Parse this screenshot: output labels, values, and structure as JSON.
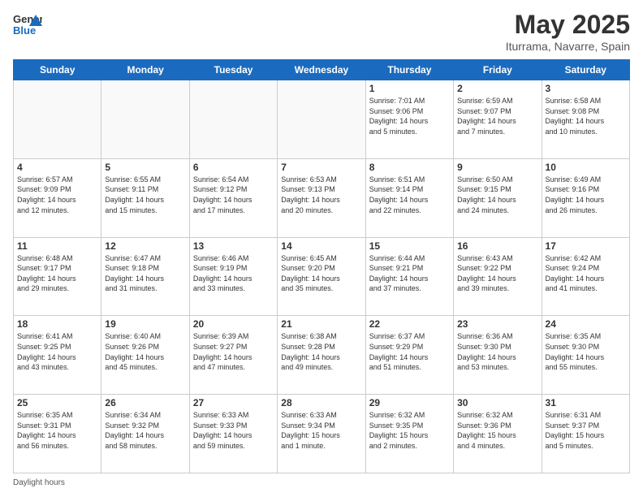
{
  "header": {
    "logo_general": "General",
    "logo_blue": "Blue",
    "month_title": "May 2025",
    "location": "Iturrama, Navarre, Spain"
  },
  "days_of_week": [
    "Sunday",
    "Monday",
    "Tuesday",
    "Wednesday",
    "Thursday",
    "Friday",
    "Saturday"
  ],
  "weeks": [
    [
      {
        "day": "",
        "info": ""
      },
      {
        "day": "",
        "info": ""
      },
      {
        "day": "",
        "info": ""
      },
      {
        "day": "",
        "info": ""
      },
      {
        "day": "1",
        "info": "Sunrise: 7:01 AM\nSunset: 9:06 PM\nDaylight: 14 hours\nand 5 minutes."
      },
      {
        "day": "2",
        "info": "Sunrise: 6:59 AM\nSunset: 9:07 PM\nDaylight: 14 hours\nand 7 minutes."
      },
      {
        "day": "3",
        "info": "Sunrise: 6:58 AM\nSunset: 9:08 PM\nDaylight: 14 hours\nand 10 minutes."
      }
    ],
    [
      {
        "day": "4",
        "info": "Sunrise: 6:57 AM\nSunset: 9:09 PM\nDaylight: 14 hours\nand 12 minutes."
      },
      {
        "day": "5",
        "info": "Sunrise: 6:55 AM\nSunset: 9:11 PM\nDaylight: 14 hours\nand 15 minutes."
      },
      {
        "day": "6",
        "info": "Sunrise: 6:54 AM\nSunset: 9:12 PM\nDaylight: 14 hours\nand 17 minutes."
      },
      {
        "day": "7",
        "info": "Sunrise: 6:53 AM\nSunset: 9:13 PM\nDaylight: 14 hours\nand 20 minutes."
      },
      {
        "day": "8",
        "info": "Sunrise: 6:51 AM\nSunset: 9:14 PM\nDaylight: 14 hours\nand 22 minutes."
      },
      {
        "day": "9",
        "info": "Sunrise: 6:50 AM\nSunset: 9:15 PM\nDaylight: 14 hours\nand 24 minutes."
      },
      {
        "day": "10",
        "info": "Sunrise: 6:49 AM\nSunset: 9:16 PM\nDaylight: 14 hours\nand 26 minutes."
      }
    ],
    [
      {
        "day": "11",
        "info": "Sunrise: 6:48 AM\nSunset: 9:17 PM\nDaylight: 14 hours\nand 29 minutes."
      },
      {
        "day": "12",
        "info": "Sunrise: 6:47 AM\nSunset: 9:18 PM\nDaylight: 14 hours\nand 31 minutes."
      },
      {
        "day": "13",
        "info": "Sunrise: 6:46 AM\nSunset: 9:19 PM\nDaylight: 14 hours\nand 33 minutes."
      },
      {
        "day": "14",
        "info": "Sunrise: 6:45 AM\nSunset: 9:20 PM\nDaylight: 14 hours\nand 35 minutes."
      },
      {
        "day": "15",
        "info": "Sunrise: 6:44 AM\nSunset: 9:21 PM\nDaylight: 14 hours\nand 37 minutes."
      },
      {
        "day": "16",
        "info": "Sunrise: 6:43 AM\nSunset: 9:22 PM\nDaylight: 14 hours\nand 39 minutes."
      },
      {
        "day": "17",
        "info": "Sunrise: 6:42 AM\nSunset: 9:24 PM\nDaylight: 14 hours\nand 41 minutes."
      }
    ],
    [
      {
        "day": "18",
        "info": "Sunrise: 6:41 AM\nSunset: 9:25 PM\nDaylight: 14 hours\nand 43 minutes."
      },
      {
        "day": "19",
        "info": "Sunrise: 6:40 AM\nSunset: 9:26 PM\nDaylight: 14 hours\nand 45 minutes."
      },
      {
        "day": "20",
        "info": "Sunrise: 6:39 AM\nSunset: 9:27 PM\nDaylight: 14 hours\nand 47 minutes."
      },
      {
        "day": "21",
        "info": "Sunrise: 6:38 AM\nSunset: 9:28 PM\nDaylight: 14 hours\nand 49 minutes."
      },
      {
        "day": "22",
        "info": "Sunrise: 6:37 AM\nSunset: 9:29 PM\nDaylight: 14 hours\nand 51 minutes."
      },
      {
        "day": "23",
        "info": "Sunrise: 6:36 AM\nSunset: 9:30 PM\nDaylight: 14 hours\nand 53 minutes."
      },
      {
        "day": "24",
        "info": "Sunrise: 6:35 AM\nSunset: 9:30 PM\nDaylight: 14 hours\nand 55 minutes."
      }
    ],
    [
      {
        "day": "25",
        "info": "Sunrise: 6:35 AM\nSunset: 9:31 PM\nDaylight: 14 hours\nand 56 minutes."
      },
      {
        "day": "26",
        "info": "Sunrise: 6:34 AM\nSunset: 9:32 PM\nDaylight: 14 hours\nand 58 minutes."
      },
      {
        "day": "27",
        "info": "Sunrise: 6:33 AM\nSunset: 9:33 PM\nDaylight: 14 hours\nand 59 minutes."
      },
      {
        "day": "28",
        "info": "Sunrise: 6:33 AM\nSunset: 9:34 PM\nDaylight: 15 hours\nand 1 minute."
      },
      {
        "day": "29",
        "info": "Sunrise: 6:32 AM\nSunset: 9:35 PM\nDaylight: 15 hours\nand 2 minutes."
      },
      {
        "day": "30",
        "info": "Sunrise: 6:32 AM\nSunset: 9:36 PM\nDaylight: 15 hours\nand 4 minutes."
      },
      {
        "day": "31",
        "info": "Sunrise: 6:31 AM\nSunset: 9:37 PM\nDaylight: 15 hours\nand 5 minutes."
      }
    ]
  ],
  "footer": {
    "daylight_hours_label": "Daylight hours"
  }
}
